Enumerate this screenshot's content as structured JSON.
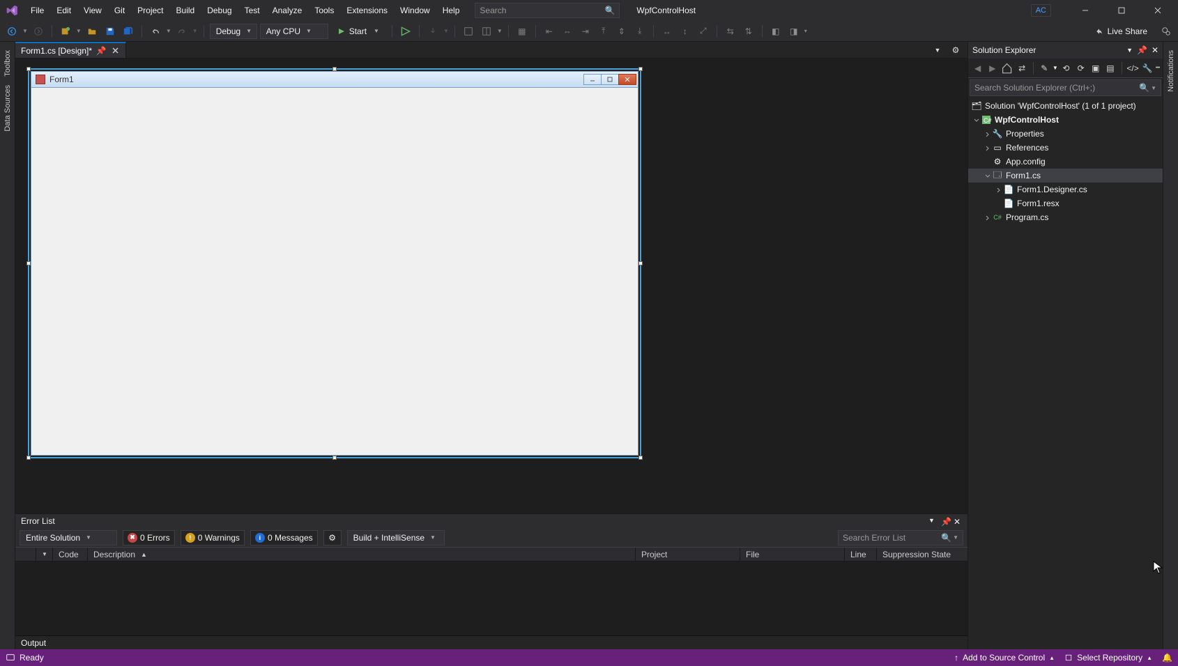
{
  "title": {
    "menus": [
      "File",
      "Edit",
      "View",
      "Git",
      "Project",
      "Build",
      "Debug",
      "Test",
      "Analyze",
      "Tools",
      "Extensions",
      "Window",
      "Help"
    ],
    "search_placeholder": "Search",
    "project_name": "WpfControlHost",
    "user_initials": "AC"
  },
  "toolbar": {
    "config": "Debug",
    "platform": "Any CPU",
    "start": "Start",
    "live_share": "Live Share"
  },
  "left_rail": {
    "toolbox": "Toolbox",
    "data_sources": "Data Sources"
  },
  "right_rail": {
    "notifications": "Notifications"
  },
  "doc_tab": {
    "label": "Form1.cs [Design]*"
  },
  "form": {
    "title": "Form1"
  },
  "solution_explorer": {
    "title": "Solution Explorer",
    "search_placeholder": "Search Solution Explorer (Ctrl+;)",
    "solution": "Solution 'WpfControlHost' (1 of 1 project)",
    "project": "WpfControlHost",
    "properties": "Properties",
    "references": "References",
    "appconfig": "App.config",
    "form1cs": "Form1.cs",
    "designer": "Form1.Designer.cs",
    "resx": "Form1.resx",
    "program": "Program.cs"
  },
  "error_list": {
    "title": "Error List",
    "scope": "Entire Solution",
    "errors": "0 Errors",
    "warnings": "0 Warnings",
    "messages": "0 Messages",
    "build_mode": "Build + IntelliSense",
    "search_placeholder": "Search Error List",
    "cols": {
      "code": "Code",
      "description": "Description",
      "project": "Project",
      "file": "File",
      "line": "Line",
      "suppression": "Suppression State"
    }
  },
  "output": {
    "title": "Output"
  },
  "status": {
    "ready": "Ready",
    "source_control": "Add to Source Control",
    "repo": "Select Repository"
  }
}
